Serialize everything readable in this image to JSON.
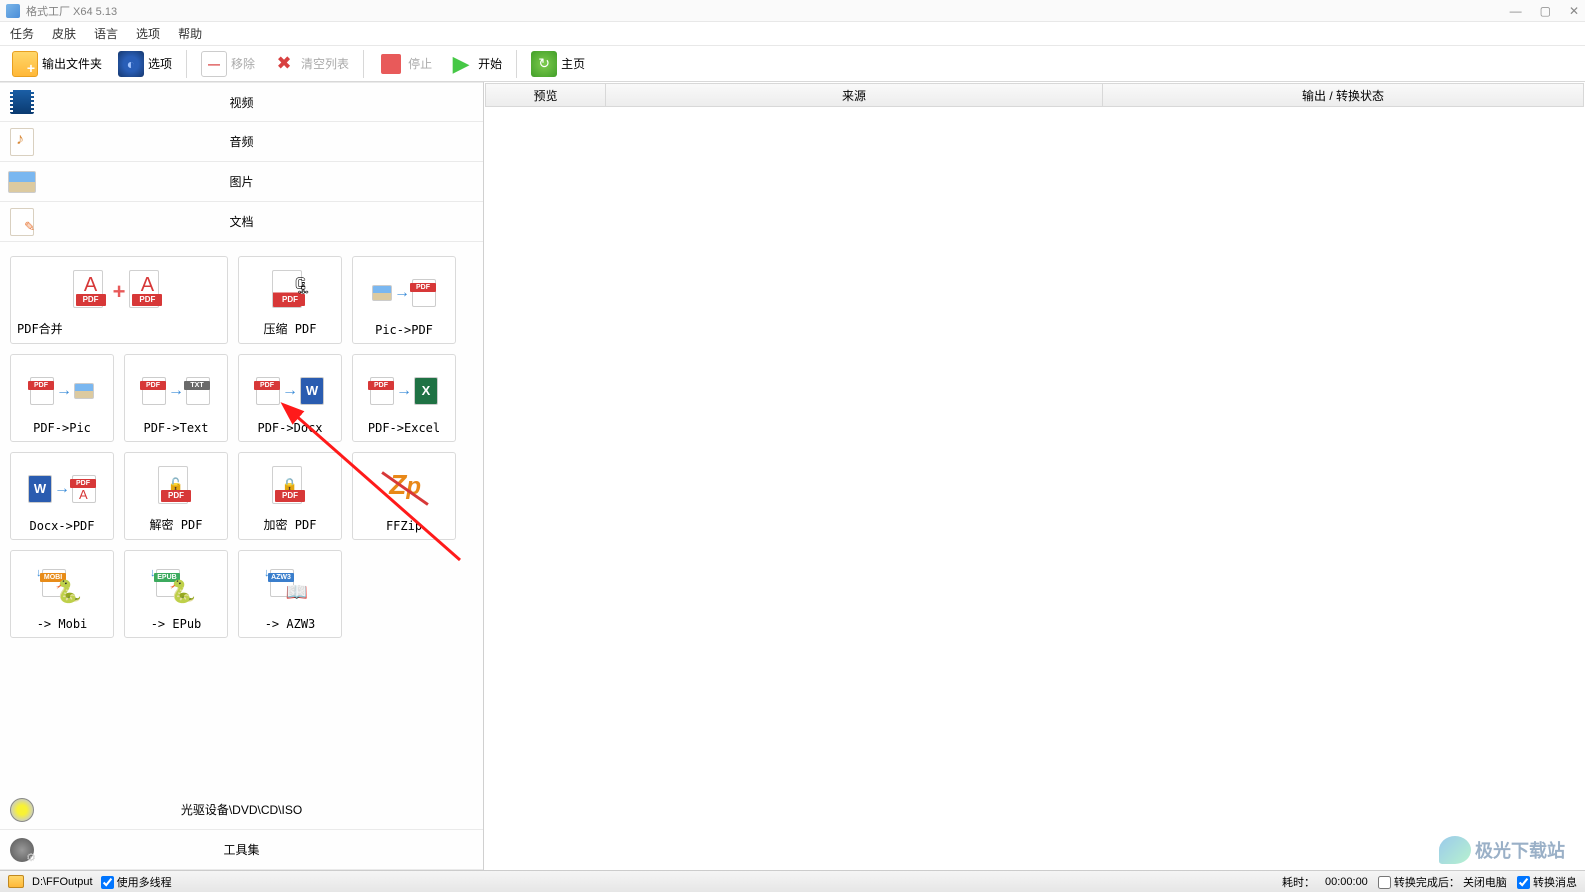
{
  "window": {
    "title": "格式工厂 X64 5.13"
  },
  "menu": [
    "任务",
    "皮肤",
    "语言",
    "选项",
    "帮助"
  ],
  "toolbar": {
    "output_folder": "输出文件夹",
    "options": "选项",
    "remove": "移除",
    "clear": "清空列表",
    "stop": "停止",
    "start": "开始",
    "home": "主页"
  },
  "categories": {
    "video": "视频",
    "audio": "音频",
    "image": "图片",
    "document": "文档",
    "optical": "光驱设备\\DVD\\CD\\ISO",
    "toolkit": "工具集"
  },
  "doc_tiles": [
    {
      "label": "PDF合并",
      "wide": true
    },
    {
      "label": "压缩 PDF"
    },
    {
      "label": "Pic->PDF"
    },
    {
      "label": "PDF->Pic"
    },
    {
      "label": "PDF->Text"
    },
    {
      "label": "PDF->Docx"
    },
    {
      "label": "PDF->Excel"
    },
    {
      "label": "Docx->PDF"
    },
    {
      "label": "解密 PDF"
    },
    {
      "label": "加密 PDF"
    },
    {
      "label": "FFZip"
    },
    {
      "label": "-> Mobi"
    },
    {
      "label": "-> EPub"
    },
    {
      "label": "-> AZW3"
    }
  ],
  "table": {
    "preview": "预览",
    "source": "来源",
    "status": "输出 / 转换状态"
  },
  "status": {
    "output_path": "D:\\FFOutput",
    "multithread": "使用多线程",
    "elapsed_label": "耗时：",
    "elapsed_value": "00:00:00",
    "after_label": "转换完成后：",
    "after_value": "关闭电脑",
    "cancel_conv": "转换消息"
  },
  "watermark": {
    "text": "极光下载站"
  }
}
